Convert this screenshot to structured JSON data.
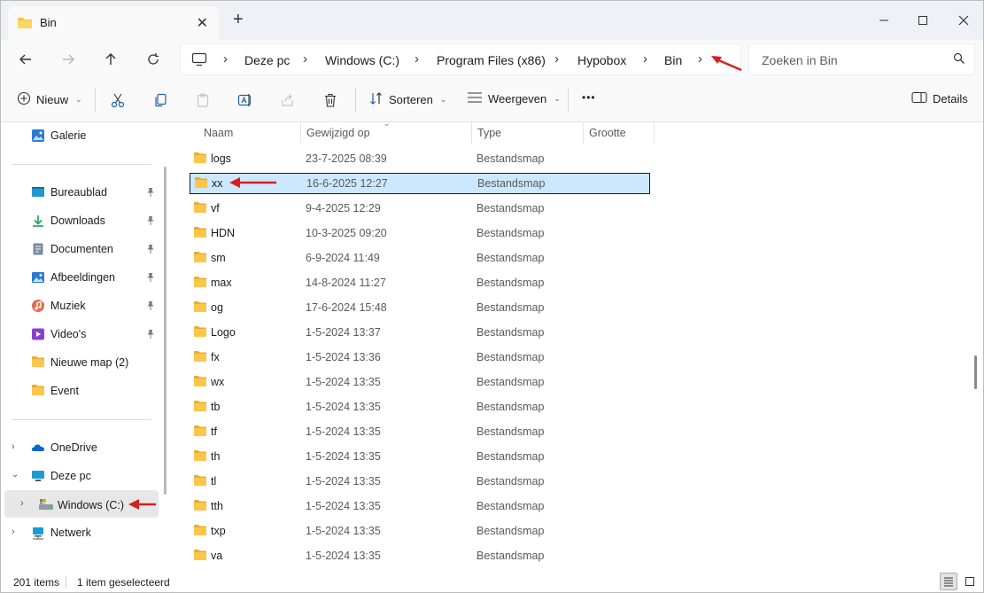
{
  "window": {
    "tab_title": "Bin",
    "tab_close": "✕",
    "tab_add": "+"
  },
  "address": {
    "crumbs": [
      "Deze pc",
      "Windows  (C:)",
      "Program Files (x86)",
      "Hypobox",
      "Bin"
    ],
    "search_placeholder": "Zoeken in Bin"
  },
  "toolbar": {
    "new_label": "Nieuw",
    "sort_label": "Sorteren",
    "view_label": "Weergeven",
    "more_label": "•••",
    "details_label": "Details"
  },
  "nav": {
    "gallery": "Galerie",
    "quick": [
      {
        "label": "Bureaublad",
        "icon": "desktop-icon",
        "pinned": true
      },
      {
        "label": "Downloads",
        "icon": "downloads-icon",
        "pinned": true
      },
      {
        "label": "Documenten",
        "icon": "documents-icon",
        "pinned": true
      },
      {
        "label": "Afbeeldingen",
        "icon": "pictures-icon",
        "pinned": true
      },
      {
        "label": "Muziek",
        "icon": "music-icon",
        "pinned": true
      },
      {
        "label": "Video's",
        "icon": "videos-icon",
        "pinned": true
      },
      {
        "label": "Nieuwe map (2)",
        "icon": "folder-icon",
        "pinned": false
      },
      {
        "label": "Event",
        "icon": "folder-icon",
        "pinned": false
      }
    ],
    "onedrive": "OneDrive",
    "thispc": "Deze pc",
    "drive": "Windows  (C:)",
    "network": "Netwerk"
  },
  "columns": {
    "name": "Naam",
    "modified": "Gewijzigd op",
    "type": "Type",
    "size": "Grootte"
  },
  "files": [
    {
      "name": "logs",
      "date": "23-7-2025 08:39",
      "type": "Bestandsmap"
    },
    {
      "name": "xx",
      "date": "16-6-2025 12:27",
      "type": "Bestandsmap",
      "selected": true
    },
    {
      "name": "vf",
      "date": "9-4-2025 12:29",
      "type": "Bestandsmap"
    },
    {
      "name": "HDN",
      "date": "10-3-2025 09:20",
      "type": "Bestandsmap"
    },
    {
      "name": "sm",
      "date": "6-9-2024 11:49",
      "type": "Bestandsmap"
    },
    {
      "name": "max",
      "date": "14-8-2024 11:27",
      "type": "Bestandsmap"
    },
    {
      "name": "og",
      "date": "17-6-2024 15:48",
      "type": "Bestandsmap"
    },
    {
      "name": "Logo",
      "date": "1-5-2024 13:37",
      "type": "Bestandsmap"
    },
    {
      "name": "fx",
      "date": "1-5-2024 13:36",
      "type": "Bestandsmap"
    },
    {
      "name": "wx",
      "date": "1-5-2024 13:35",
      "type": "Bestandsmap"
    },
    {
      "name": "tb",
      "date": "1-5-2024 13:35",
      "type": "Bestandsmap"
    },
    {
      "name": "tf",
      "date": "1-5-2024 13:35",
      "type": "Bestandsmap"
    },
    {
      "name": "th",
      "date": "1-5-2024 13:35",
      "type": "Bestandsmap"
    },
    {
      "name": "tl",
      "date": "1-5-2024 13:35",
      "type": "Bestandsmap"
    },
    {
      "name": "tth",
      "date": "1-5-2024 13:35",
      "type": "Bestandsmap"
    },
    {
      "name": "txp",
      "date": "1-5-2024 13:35",
      "type": "Bestandsmap"
    },
    {
      "name": "va",
      "date": "1-5-2024 13:35",
      "type": "Bestandsmap"
    }
  ],
  "status": {
    "count": "201 items",
    "selected": "1 item geselecteerd"
  },
  "colors": {
    "accent": "#0067c0",
    "selection": "#cce8ff",
    "folder": "#f8c43f",
    "annotation_arrow": "#d42020"
  }
}
